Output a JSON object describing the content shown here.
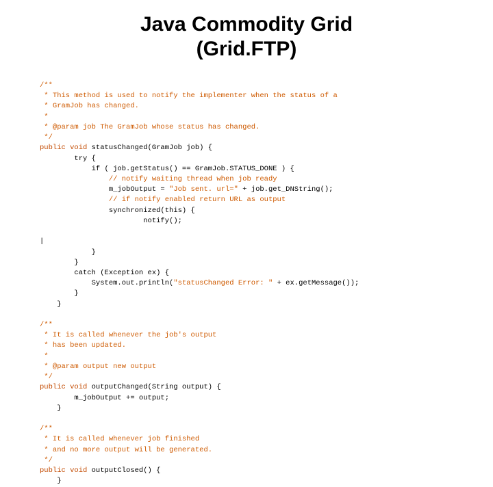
{
  "title_line1": "Java Commodity Grid",
  "title_line2": "(Grid.FTP)",
  "code": {
    "l01": "/**",
    "l02": " * This method is used to notify the implementer when the status of a",
    "l03": " * GramJob has changed.",
    "l04": " *",
    "l05": " * @param job The GramJob whose status has changed.",
    "l06": " */",
    "l07a": "public void",
    "l07b": " statusChanged(GramJob job) {",
    "l08": "        try {",
    "l09": "            if ( job.getStatus() == GramJob.STATUS_DONE ) {",
    "l10": "                // notify waiting thread when job ready",
    "l11a": "                m_jobOutput = ",
    "l11b": "\"Job sent. url=\"",
    "l11c": " + job.get_DNString();",
    "l12": "                // if notify enabled return URL as output",
    "l13": "                synchronized(this) {",
    "l14": "                        notify();",
    "l15": "",
    "l16": "|",
    "l17": "            }",
    "l18": "        }",
    "l19": "        catch (Exception ex) {",
    "l20a": "            System.out.println(",
    "l20b": "\"statusChanged Error: \"",
    "l20c": " + ex.getMessage());",
    "l21": "        }",
    "l22": "    }",
    "l23": "",
    "l24": "/**",
    "l25": " * It is called whenever the job's output",
    "l26": " * has been updated.",
    "l27": " *",
    "l28": " * @param output new output",
    "l29": " */",
    "l30a": "public void",
    "l30b": " outputChanged(String output) {",
    "l31": "        m_jobOutput += output;",
    "l32": "    }",
    "l33": "",
    "l34": "/**",
    "l35": " * It is called whenever job finished",
    "l36": " * and no more output will be generated.",
    "l37": " */",
    "l38a": "public void",
    "l38b": " outputClosed() {",
    "l39": "    }"
  }
}
